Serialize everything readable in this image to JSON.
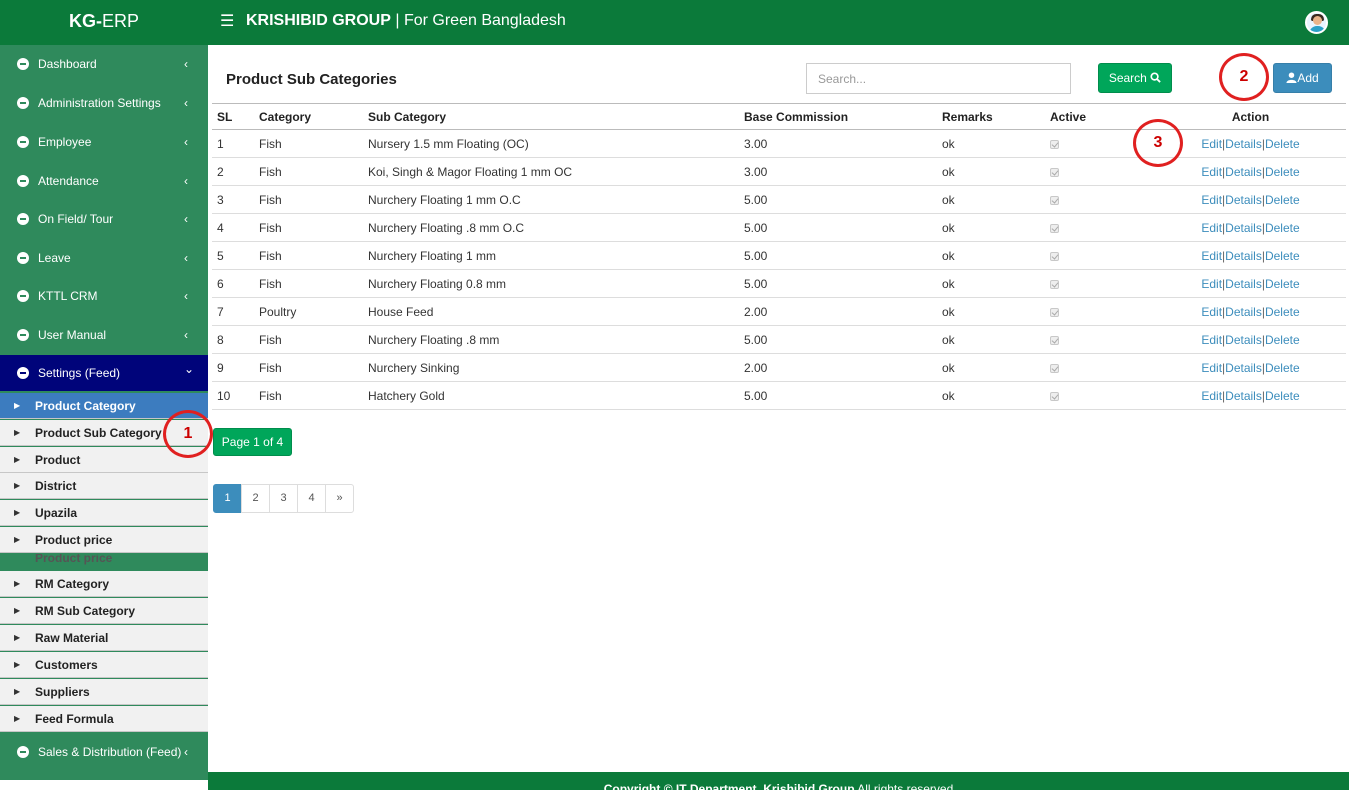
{
  "header": {
    "brand_bold": "KG-",
    "brand_rest": "ERP",
    "menu_icon": "hamburger-icon",
    "company_bold": "KRISHIBID GROUP",
    "company_rest": " | For Green Bangladesh",
    "avatar": "user-avatar"
  },
  "sidebar": {
    "menu": [
      {
        "label": "Dashboard"
      },
      {
        "label": "Administration Settings"
      },
      {
        "label": "Employee"
      },
      {
        "label": "Attendance"
      },
      {
        "label": "On Field/ Tour"
      },
      {
        "label": "Leave"
      },
      {
        "label": "KTTL CRM"
      },
      {
        "label": "User Manual"
      },
      {
        "label": "Settings (Feed)"
      }
    ],
    "chevron_left": "‹",
    "chevron_down": "⌄",
    "submenu": [
      {
        "label": "Product Category"
      },
      {
        "label": "Product Sub Category"
      },
      {
        "label": "Product"
      },
      {
        "label": "District"
      },
      {
        "label": "Upazila"
      },
      {
        "label": "Product price"
      },
      {
        "label": "RM Category"
      },
      {
        "label": "RM Sub Category"
      },
      {
        "label": "Raw Material"
      },
      {
        "label": "Customers"
      },
      {
        "label": "Suppliers"
      },
      {
        "label": "Feed Formula"
      }
    ],
    "ghost_label": "Product price",
    "last_menu": {
      "label": "Sales & Distribution (Feed)"
    }
  },
  "main": {
    "title": "Product Sub Categories",
    "search_placeholder": "Search...",
    "search_label": "Search",
    "add_label": "Add",
    "page_label": "Page 1 of 4"
  },
  "table": {
    "headers": {
      "sl": "SL",
      "category": "Category",
      "sub_category": "Sub Category",
      "base_commission": "Base Commission",
      "remarks": "Remarks",
      "active": "Active",
      "action": "Action"
    },
    "rows": [
      {
        "sl": "1",
        "category": "Fish",
        "sub_category": "Nursery 1.5 mm Floating (OC)",
        "base_commission": "3.00",
        "remarks": "ok",
        "active": true
      },
      {
        "sl": "2",
        "category": "Fish",
        "sub_category": "Koi, Singh & Magor Floating 1 mm OC",
        "base_commission": "3.00",
        "remarks": "ok",
        "active": true
      },
      {
        "sl": "3",
        "category": "Fish",
        "sub_category": "Nurchery Floating 1 mm O.C",
        "base_commission": "5.00",
        "remarks": "ok",
        "active": true
      },
      {
        "sl": "4",
        "category": "Fish",
        "sub_category": "Nurchery Floating .8 mm O.C",
        "base_commission": "5.00",
        "remarks": "ok",
        "active": true
      },
      {
        "sl": "5",
        "category": "Fish",
        "sub_category": "Nurchery Floating 1 mm",
        "base_commission": "5.00",
        "remarks": "ok",
        "active": true
      },
      {
        "sl": "6",
        "category": "Fish",
        "sub_category": "Nurchery Floating 0.8 mm",
        "base_commission": "5.00",
        "remarks": "ok",
        "active": true
      },
      {
        "sl": "7",
        "category": "Poultry",
        "sub_category": "House Feed",
        "base_commission": "2.00",
        "remarks": "ok",
        "active": true
      },
      {
        "sl": "8",
        "category": "Fish",
        "sub_category": "Nurchery Floating .8 mm",
        "base_commission": "5.00",
        "remarks": "ok",
        "active": true
      },
      {
        "sl": "9",
        "category": "Fish",
        "sub_category": "Nurchery Sinking",
        "base_commission": "2.00",
        "remarks": "ok",
        "active": true
      },
      {
        "sl": "10",
        "category": "Fish",
        "sub_category": "Hatchery Gold",
        "base_commission": "5.00",
        "remarks": "ok",
        "active": true
      }
    ],
    "actions": {
      "edit": "Edit",
      "details": "Details",
      "delete": "Delete",
      "separator": "|"
    }
  },
  "pagination": {
    "pages": [
      "1",
      "2",
      "3",
      "4",
      "»"
    ],
    "current": "1"
  },
  "callouts": [
    "1",
    "2",
    "3"
  ],
  "footer": {
    "bold": "Copyright © IT Department, Krishibid Group",
    "rest": " All rights reserved"
  },
  "colors": {
    "brand_green": "#0b7a3a",
    "sidebar_green": "#2f8a5c",
    "active_menu": "#00047a",
    "active_submenu": "#3c7cbf",
    "button_green": "#00a65a",
    "button_blue": "#3c8dbc",
    "callout_red": "#e02020"
  }
}
